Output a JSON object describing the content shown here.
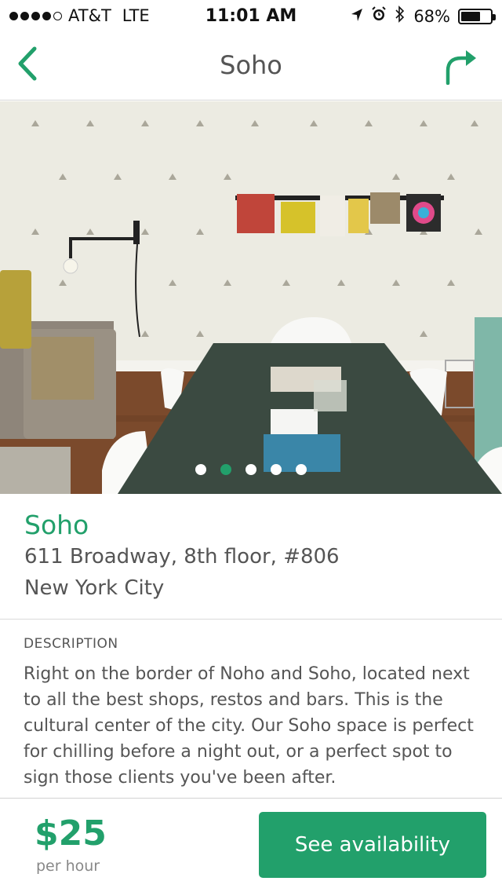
{
  "status_bar": {
    "carrier": "AT&T",
    "network": "LTE",
    "time": "11:01 AM",
    "battery": "68%",
    "battery_level": 0.68,
    "signal_bars": 4,
    "icons": [
      "location-arrow-icon",
      "alarm-icon",
      "bluetooth-icon",
      "battery-icon"
    ]
  },
  "nav": {
    "title": "Soho",
    "back_icon": "chevron-left-icon",
    "share_icon": "share-arrow-icon"
  },
  "gallery": {
    "page_count": 5,
    "active_index": 1
  },
  "space": {
    "name": "Soho",
    "address_line1": "611 Broadway, 8th floor, #806",
    "address_line2": "New York City"
  },
  "description": {
    "label": "DESCRIPTION",
    "text": "Right on the border of Noho and Soho, located next to all the best shops, restos and bars. This is the cultural center of the city. Our Soho space is perfect for chilling before a night out, or a perfect spot to sign those clients you've been after."
  },
  "booking": {
    "price": "$25",
    "unit": "per hour",
    "cta_label": "See availability"
  },
  "colors": {
    "accent": "#22a06b",
    "text": "#555555"
  }
}
